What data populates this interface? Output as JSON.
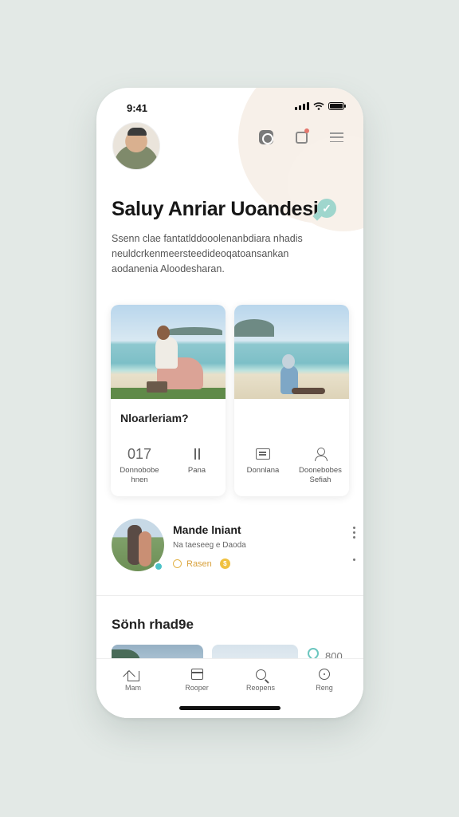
{
  "status_bar": {
    "time": "9:41"
  },
  "header": {
    "title": "Saluy Anriar Uoandesia",
    "description": "Ssenn clae fantatlddooolenanbdiara nhadis neuldcrkenmeersteedideoqatoansankan aodanenia Aloodesharan.",
    "icons": [
      "puzzle-icon",
      "bag-icon",
      "menu-icon"
    ],
    "accent_color": "#9fd6cd"
  },
  "cards": [
    {
      "title": "Nloarleriam?",
      "stats": [
        {
          "value": "017",
          "label": "Donnobobe hnen"
        },
        {
          "icon": "sort-icon",
          "label": "Pana"
        }
      ]
    },
    {
      "title": "",
      "stats": [
        {
          "icon": "card-icon",
          "label": "Donnlana"
        },
        {
          "icon": "user-icon",
          "label": "Doonebobes Sefiah"
        }
      ]
    }
  ],
  "listing": {
    "name": "Mande lniant",
    "subtitle": "Na taeseeg e Daoda",
    "tag": "Rasen"
  },
  "section": {
    "title": "Sönh rhad9e",
    "peek_text": "800"
  },
  "tabbar": {
    "items": [
      {
        "label": "Mam",
        "icon": "home-icon"
      },
      {
        "label": "Rooper",
        "icon": "calendar-icon"
      },
      {
        "label": "Reopens",
        "icon": "search-icon"
      },
      {
        "label": "Reng",
        "icon": "clock-icon"
      }
    ]
  }
}
